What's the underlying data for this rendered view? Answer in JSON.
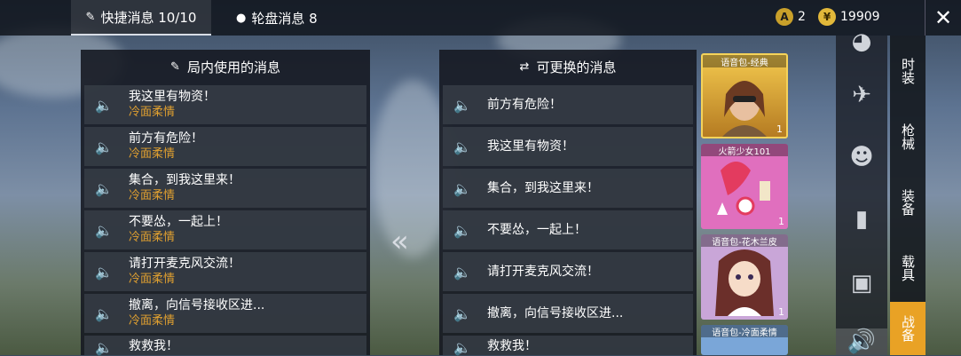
{
  "topbar": {
    "tab_quick": {
      "label": "快捷消息 10/10",
      "icon": "chat-icon"
    },
    "tab_wheel": {
      "label": "轮盘消息 8",
      "icon": "map-pin-icon"
    },
    "currency_a": {
      "value": "2",
      "icon": "ag-coin-icon"
    },
    "currency_b": {
      "value": "19909",
      "icon": "uc-coin-icon"
    },
    "close_icon": "close-icon"
  },
  "left_panel": {
    "title": "局内使用的消息",
    "items": [
      {
        "text": "我这里有物资！",
        "sub": "冷面柔情"
      },
      {
        "text": "前方有危险！",
        "sub": "冷面柔情"
      },
      {
        "text": "集合，到我这里来！",
        "sub": "冷面柔情"
      },
      {
        "text": "不要怂，一起上！",
        "sub": "冷面柔情"
      },
      {
        "text": "请打开麦克风交流！",
        "sub": "冷面柔情"
      },
      {
        "text": "撤离，向信号接收区进...",
        "sub": "冷面柔情"
      },
      {
        "text": "救救我！",
        "sub": ""
      }
    ]
  },
  "right_panel": {
    "title": "可更换的消息",
    "items": [
      {
        "text": "前方有危险！"
      },
      {
        "text": "我这里有物资！"
      },
      {
        "text": "集合，到我这里来！"
      },
      {
        "text": "不要怂，一起上！"
      },
      {
        "text": "请打开麦克风交流！"
      },
      {
        "text": "撤离，向信号接收区进..."
      },
      {
        "text": "救救我！"
      }
    ]
  },
  "transfer_arrow": "«",
  "voice_packs": [
    {
      "label": "语音包-经典",
      "count": "1",
      "color": "#d9a234"
    },
    {
      "label": "火箭少女101",
      "count": "1",
      "color": "#e06fbe"
    },
    {
      "label": "语音包-花木兰皮",
      "count": "1",
      "color": "#b58bc9"
    },
    {
      "label": "语音包-冷面柔情",
      "count": "",
      "color": "#7aa6d8"
    }
  ],
  "icon_column": [
    "helmet-icon",
    "plane-icon",
    "emoji-icon",
    "spray-can-icon",
    "gallery-icon",
    "speaker-icon"
  ],
  "categories": [
    {
      "label": "时装"
    },
    {
      "label": "枪械"
    },
    {
      "label": "装备"
    },
    {
      "label": "载具"
    },
    {
      "label": "战备"
    }
  ],
  "colors": {
    "accent": "#e9a225",
    "subtitle": "#e0a030"
  }
}
